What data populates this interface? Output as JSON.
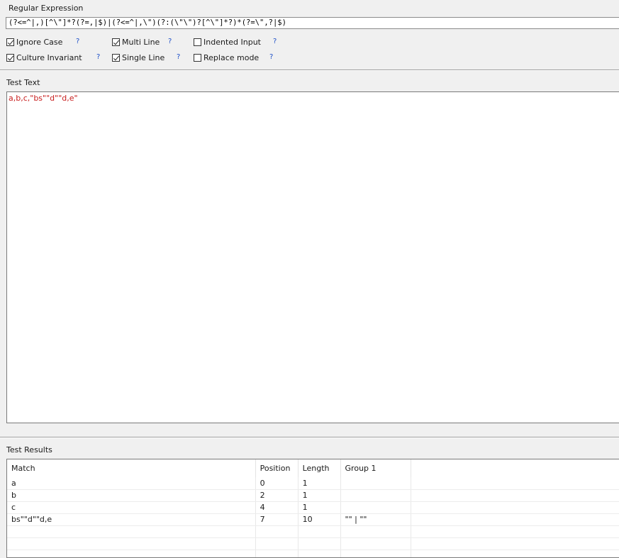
{
  "regex": {
    "label": "Regular Expression",
    "value": "(?<=^|,)[^\\\"]*?(?=,|$)|(?<=^|,\\\")(?:(\\\"\\\")?[^\\\"]*?)*(?=\\\",?|$)"
  },
  "options": [
    {
      "label": "Ignore Case",
      "checked": true,
      "help": "?"
    },
    {
      "label": "Multi Line",
      "checked": true,
      "help": "?"
    },
    {
      "label": "Indented Input",
      "checked": false,
      "help": "?"
    },
    {
      "label": "Culture Invariant",
      "checked": true,
      "help": "?"
    },
    {
      "label": "Single Line",
      "checked": true,
      "help": "?"
    },
    {
      "label": "Replace mode",
      "checked": false,
      "help": "?"
    }
  ],
  "test_text": {
    "label": "Test Text",
    "value": "a,b,c,\"bs\"\"d\"\"d,e\""
  },
  "results": {
    "label": "Test Results",
    "columns": [
      "Match",
      "Position",
      "Length",
      "Group 1"
    ],
    "rows": [
      [
        "a",
        "0",
        "1",
        ""
      ],
      [
        "b",
        "2",
        "1",
        ""
      ],
      [
        "c",
        "4",
        "1",
        ""
      ],
      [
        "bs\"\"d\"\"d,e",
        "7",
        "10",
        "\"\" | \"\""
      ]
    ]
  }
}
